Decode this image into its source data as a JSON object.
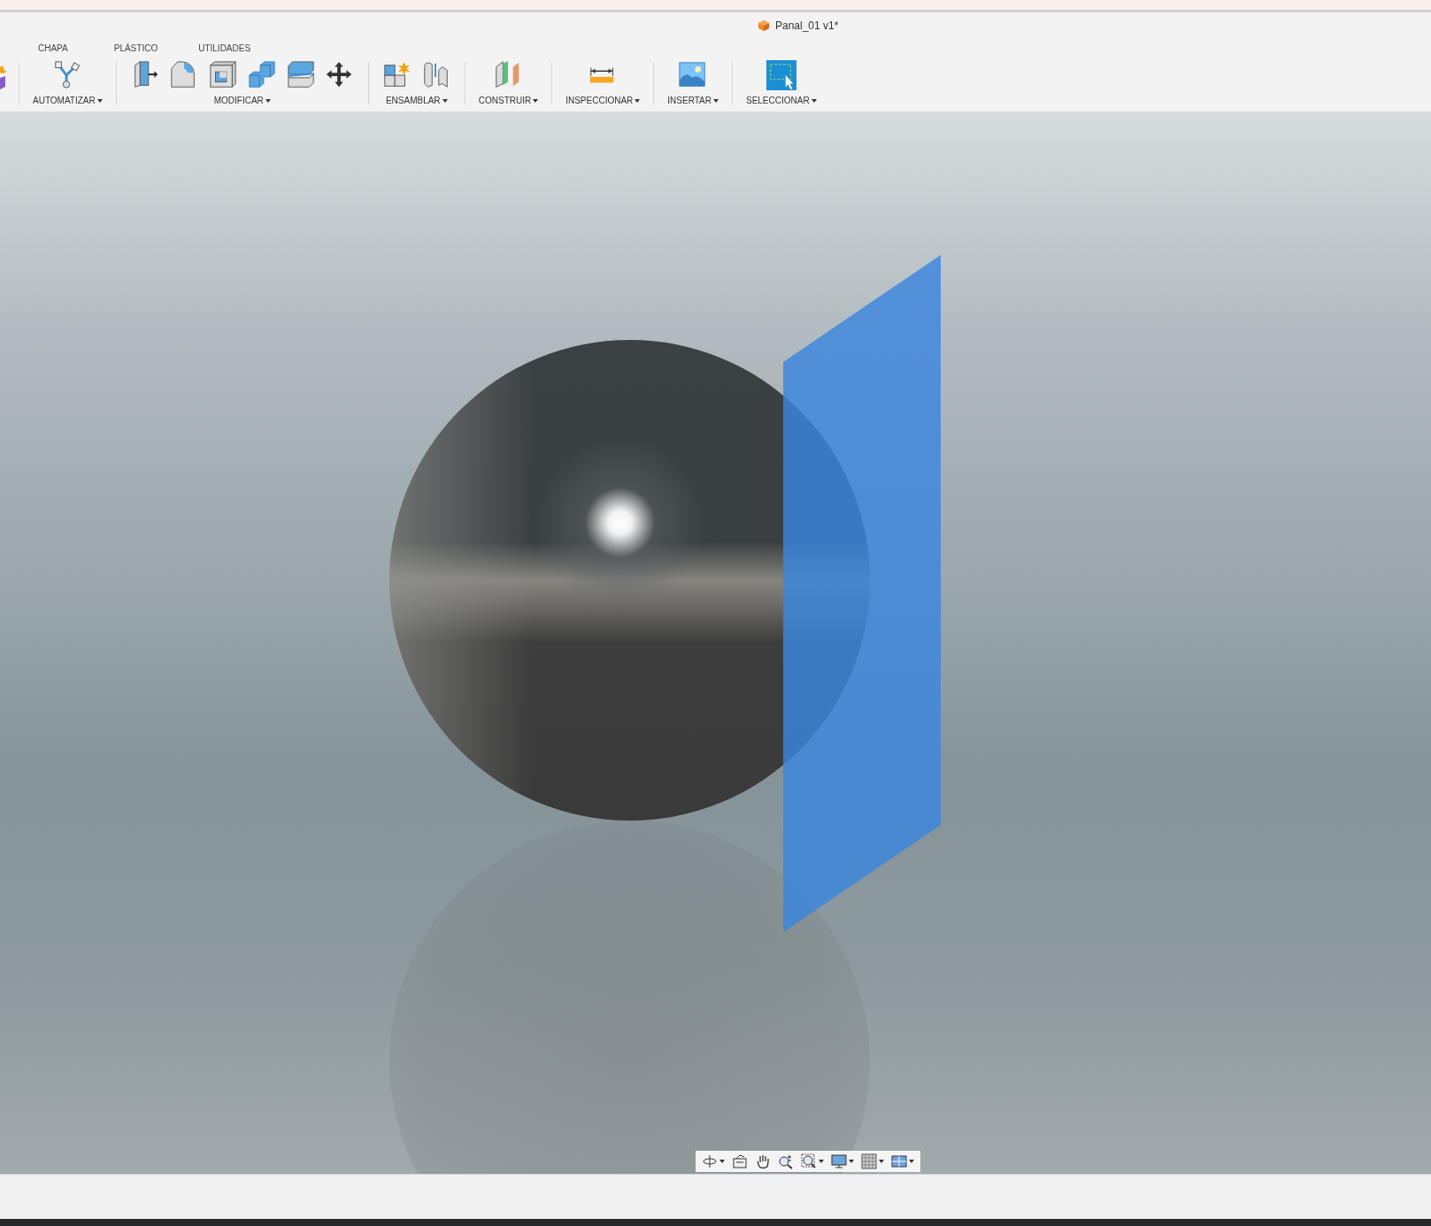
{
  "window": {
    "title": "Panal_01 v1*"
  },
  "tabs": [
    {
      "label": "CHAPA"
    },
    {
      "label": "PLÁSTICO"
    },
    {
      "label": "UTILIDADES"
    }
  ],
  "toolbar": {
    "groups": [
      {
        "label": "AUTOMATIZAR",
        "tools": [
          {
            "kind": "script"
          }
        ]
      },
      {
        "label": "MODIFICAR",
        "tools": [
          {
            "kind": "presspull"
          },
          {
            "kind": "fillet"
          },
          {
            "kind": "shell"
          },
          {
            "kind": "combine"
          },
          {
            "kind": "split"
          },
          {
            "kind": "move"
          }
        ]
      },
      {
        "label": "ENSAMBLAR",
        "tools": [
          {
            "kind": "component"
          },
          {
            "kind": "joint"
          }
        ]
      },
      {
        "label": "CONSTRUIR",
        "tools": [
          {
            "kind": "plane"
          }
        ]
      },
      {
        "label": "INSPECCIONAR",
        "tools": [
          {
            "kind": "measure"
          }
        ]
      },
      {
        "label": "INSERTAR",
        "tools": [
          {
            "kind": "image"
          }
        ]
      },
      {
        "label": "SELECCIONAR",
        "tools": [
          {
            "kind": "select"
          }
        ]
      }
    ]
  },
  "navbar": {
    "items": [
      {
        "kind": "orbit",
        "dropdown": true
      },
      {
        "kind": "look",
        "dropdown": false
      },
      {
        "kind": "pan",
        "dropdown": false
      },
      {
        "kind": "zoom",
        "dropdown": false
      },
      {
        "kind": "fit",
        "dropdown": true
      },
      {
        "kind": "display",
        "dropdown": true
      },
      {
        "kind": "grid",
        "dropdown": true
      },
      {
        "kind": "viewports",
        "dropdown": true
      }
    ]
  }
}
